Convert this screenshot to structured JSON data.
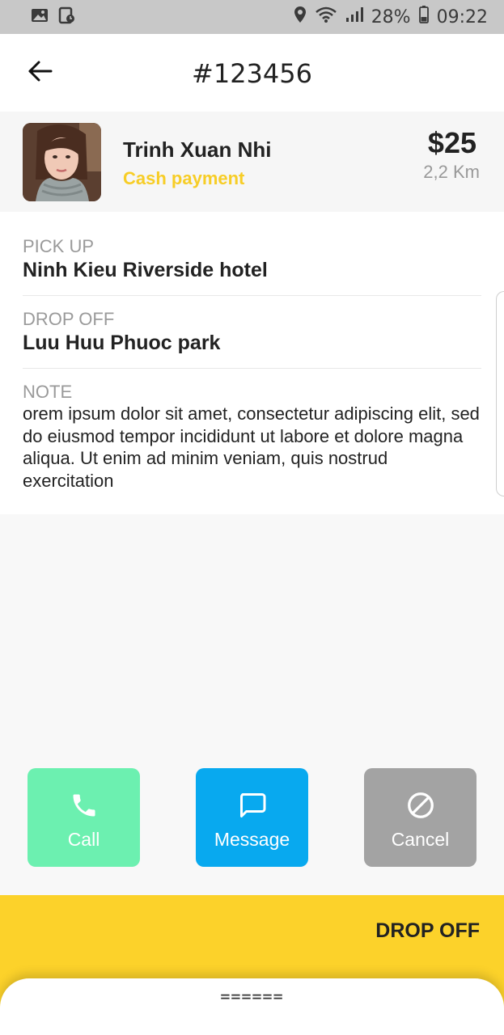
{
  "status_bar": {
    "battery": "28%",
    "time": "09:22",
    "icons": [
      "gallery-icon",
      "screenshot-icon",
      "location-icon",
      "wifi-icon",
      "signal-icon",
      "battery-icon"
    ]
  },
  "header": {
    "back_icon": "arrow-left-icon",
    "title": "#123456"
  },
  "customer": {
    "name": "Trinh Xuan Nhi",
    "payment": "Cash payment",
    "price": "$25",
    "distance": "2,2 Km",
    "payment_color": "#f7cd26"
  },
  "trip": {
    "pickup_label": "PICK UP",
    "pickup_value": "Ninh Kieu Riverside hotel",
    "dropoff_label": "DROP OFF",
    "dropoff_value": "Luu Huu Phuoc park",
    "note_label": "NOTE",
    "note_value": "orem ipsum dolor sit amet, consectetur adipiscing elit, sed do eiusmod tempor incididunt ut labore et dolore magna aliqua. Ut enim ad minim veniam, quis nostrud exercitation"
  },
  "actions": {
    "call_label": "Call",
    "message_label": "Message",
    "cancel_label": "Cancel",
    "colors": {
      "call": "#6cf0b0",
      "message": "#08a9ef",
      "cancel": "#a3a3a3"
    }
  },
  "bottom": {
    "drop_off_button": "DROP OFF",
    "sheet_handle": "======",
    "accent": "#fcd22a"
  }
}
